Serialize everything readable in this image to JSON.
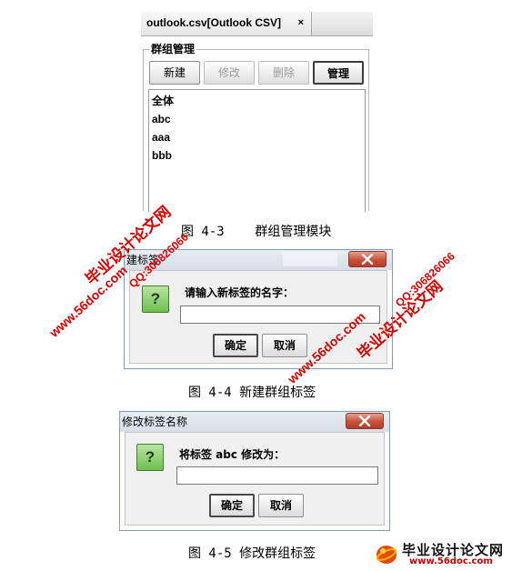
{
  "figure_4_3": {
    "tab_title": "outlook.csv[Outlook CSV]",
    "tab_close": "×",
    "group_title": "群组管理",
    "buttons": {
      "new": "新建",
      "edit": "修改",
      "delete": "删除",
      "manage": "管理"
    },
    "groups": [
      "全体",
      "abc",
      "aaa",
      "bbb"
    ],
    "caption": "图 4-3    群组管理模块"
  },
  "figure_4_4": {
    "window_title": "建标签",
    "icon_glyph": "?",
    "prompt": "请输入新标签的名字：",
    "input_value": "",
    "ok": "确定",
    "cancel": "取消",
    "caption": "图 4-4 新建群组标签"
  },
  "figure_4_5": {
    "window_title": "修改标签名称",
    "icon_glyph": "?",
    "prompt": "将标签 abc 修改为：",
    "input_value": "",
    "ok": "确定",
    "cancel": "取消",
    "caption": "图 4-5 修改群组标签"
  },
  "watermarks": {
    "site_name": "毕业设计论文网",
    "site_url": "www.56doc.com",
    "qq": "QQ:306826066"
  },
  "footer_logo": {
    "title": "毕业设计论文网",
    "url": "www.56doc.com"
  },
  "colors": {
    "watermark": "#d40000",
    "question_icon": "#6fbf4f",
    "close_button": "#c8503a"
  }
}
